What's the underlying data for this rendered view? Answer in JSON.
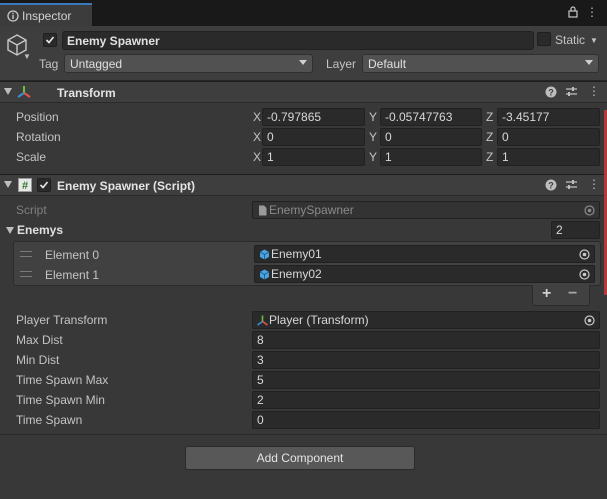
{
  "tab": {
    "label": "Inspector",
    "menu_glyph": "⋮"
  },
  "header": {
    "name": "Enemy Spawner",
    "static_label": "Static",
    "tag_label": "Tag",
    "tag_value": "Untagged",
    "layer_label": "Layer",
    "layer_value": "Default"
  },
  "transform": {
    "title": "Transform",
    "rows": [
      {
        "label": "Position",
        "x": "-0.797865",
        "y": "-0.05747763",
        "z": "-3.45177"
      },
      {
        "label": "Rotation",
        "x": "0",
        "y": "0",
        "z": "0"
      },
      {
        "label": "Scale",
        "x": "1",
        "y": "1",
        "z": "1"
      }
    ],
    "axes": {
      "x": "X",
      "y": "Y",
      "z": "Z"
    }
  },
  "script_component": {
    "title": "Enemy Spawner (Script)",
    "script_label": "Script",
    "script_value": "EnemySpawner",
    "enemys_label": "Enemys",
    "enemys_count": "2",
    "elements": [
      {
        "label": "Element 0",
        "value": "Enemy01"
      },
      {
        "label": "Element 1",
        "value": "Enemy02"
      }
    ],
    "plus": "+",
    "minus": "−",
    "fields": [
      {
        "label": "Player Transform",
        "value": "Player (Transform)"
      },
      {
        "label": "Max Dist",
        "value": "8"
      },
      {
        "label": "Min Dist",
        "value": "3"
      },
      {
        "label": "Time Spawn Max",
        "value": "5"
      },
      {
        "label": "Time Spawn Min",
        "value": "2"
      },
      {
        "label": "Time Spawn",
        "value": "0"
      }
    ]
  },
  "add_component": "Add Component",
  "colors": {
    "accent": "#3a79bb",
    "error_bar": "#b33a3a"
  }
}
